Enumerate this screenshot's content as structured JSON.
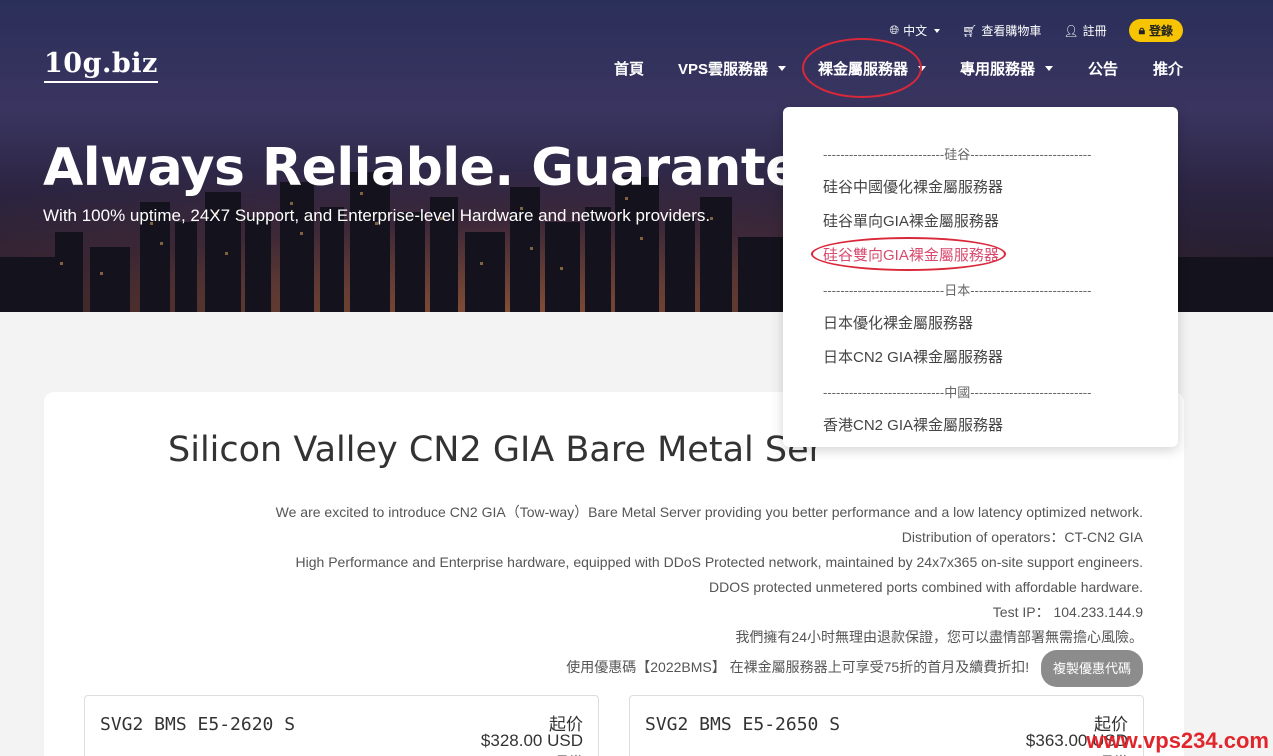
{
  "brand": {
    "logo": "10g.biz"
  },
  "topbar": {
    "language": "中文",
    "cart": "查看購物車",
    "register": "註冊",
    "login": "登錄"
  },
  "nav": {
    "items": [
      {
        "label": "首頁"
      },
      {
        "label": "VPS雲服務器"
      },
      {
        "label": "裸金屬服務器"
      },
      {
        "label": "專用服務器"
      },
      {
        "label": "公告"
      },
      {
        "label": "推介"
      }
    ]
  },
  "hero": {
    "title": "Always Reliable. Guaranteed",
    "subtitle": "With 100% uptime, 24X7 Support, and Enterprise-level Hardware and network providers."
  },
  "dropdown": {
    "items": [
      {
        "label": "----------------------------硅谷----------------------------",
        "type": "separator"
      },
      {
        "label": "硅谷中國優化裸金屬服務器",
        "type": "link"
      },
      {
        "label": "硅谷單向GIA裸金屬服務器",
        "type": "link"
      },
      {
        "label": "硅谷雙向GIA裸金屬服務器",
        "type": "link-active"
      },
      {
        "label": "----------------------------日本----------------------------",
        "type": "separator"
      },
      {
        "label": "日本優化裸金屬服務器",
        "type": "link"
      },
      {
        "label": "日本CN2 GIA裸金屬服務器",
        "type": "link"
      },
      {
        "label": "----------------------------中國----------------------------",
        "type": "separator"
      },
      {
        "label": "香港CN2 GIA裸金屬服務器",
        "type": "link"
      }
    ]
  },
  "main": {
    "title": "Silicon Valley CN2 GIA Bare Metal Ser",
    "description": [
      "We are excited to introduce CN2 GIA（Tow-way）Bare Metal Server providing you better performance and a low latency optimized network.",
      "Distribution of operators：CT-CN2 GIA",
      "High Performance and Enterprise hardware, equipped with DDoS Protected network, maintained by 24x7x365 on-site support engineers.",
      "DDOS protected unmetered ports combined with affordable hardware.",
      "Test IP： 104.233.144.9",
      "我們擁有24小时無理由退款保證，您可以盡情部署無需擔心風險。",
      "使用優惠碼【2022BMS】 在裸金屬服務器上可享受75折的首月及續費折扣!"
    ],
    "coupon_button": "複製優惠代碼",
    "plans": [
      {
        "name": "SVG2 BMS E5-2620 S",
        "from_label": "起价",
        "price": "$328.00 USD",
        "cycle": "月繳"
      },
      {
        "name": "SVG2 BMS E5-2650 S",
        "from_label": "起价",
        "price": "$363.00 USD",
        "cycle": "月繳"
      }
    ]
  },
  "watermark": "www.vps234.com",
  "colors": {
    "accent_login": "#f6c400",
    "annotation": "#d9283a",
    "active_link": "#d94b6e",
    "watermark": "#e0262c"
  }
}
